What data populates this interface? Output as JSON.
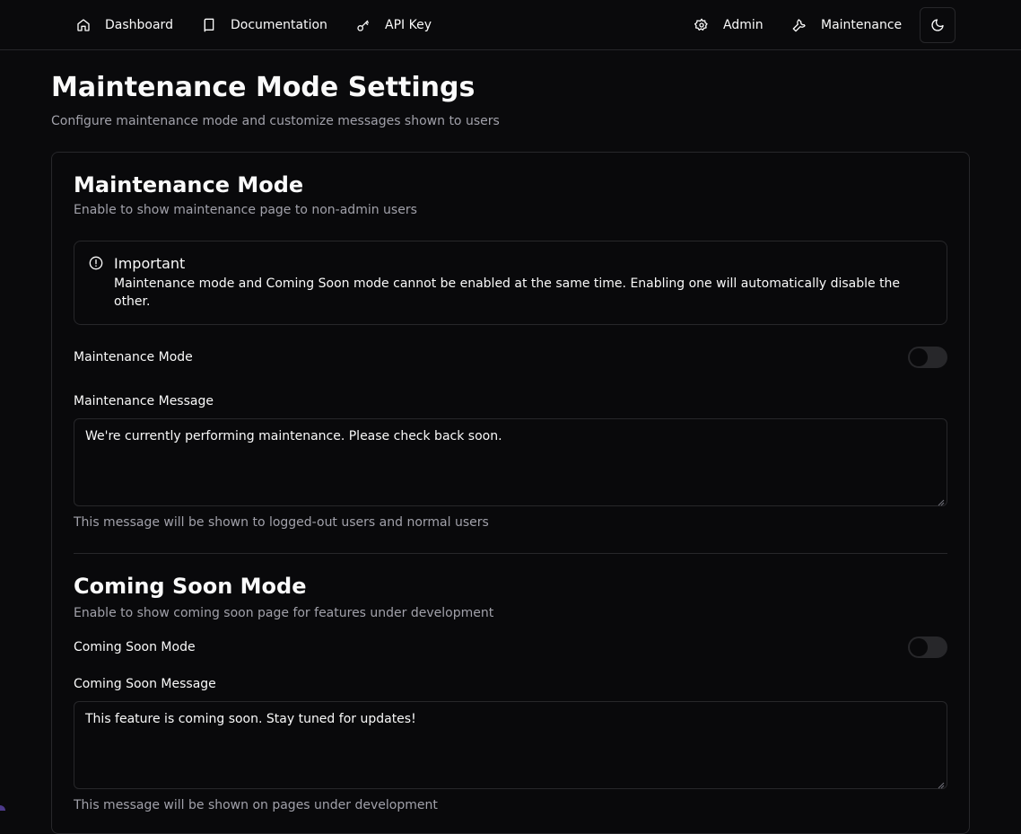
{
  "nav": {
    "dashboard": "Dashboard",
    "documentation": "Documentation",
    "api_key": "API Key",
    "admin": "Admin",
    "maintenance": "Maintenance"
  },
  "icons": {
    "dashboard": "home-icon",
    "documentation": "book-icon",
    "api_key": "key-icon",
    "admin": "gear-icon",
    "maintenance": "wrench-icon",
    "theme": "moon-icon",
    "alert": "alert-circle-icon"
  },
  "page": {
    "title": "Maintenance Mode Settings",
    "subtitle": "Configure maintenance mode and customize messages shown to users"
  },
  "maintenance": {
    "title": "Maintenance Mode",
    "subtitle": "Enable to show maintenance page to non-admin users",
    "alert_title": "Important",
    "alert_text": "Maintenance mode and Coming Soon mode cannot be enabled at the same time. Enabling one will automatically disable the other.",
    "toggle_label": "Maintenance Mode",
    "toggle_on": false,
    "message_label": "Maintenance Message",
    "message_value": "We're currently performing maintenance. Please check back soon.",
    "help": "This message will be shown to logged-out users and normal users"
  },
  "coming_soon": {
    "title": "Coming Soon Mode",
    "subtitle": "Enable to show coming soon page for features under development",
    "toggle_label": "Coming Soon Mode",
    "toggle_on": false,
    "message_label": "Coming Soon Message",
    "message_value": "This feature is coming soon. Stay tuned for updates!",
    "help": "This message will be shown on pages under development"
  },
  "colors": {
    "background": "#0a0a0c",
    "border": "#27272a",
    "muted_text": "#a1a1aa",
    "text": "#fafafa"
  }
}
